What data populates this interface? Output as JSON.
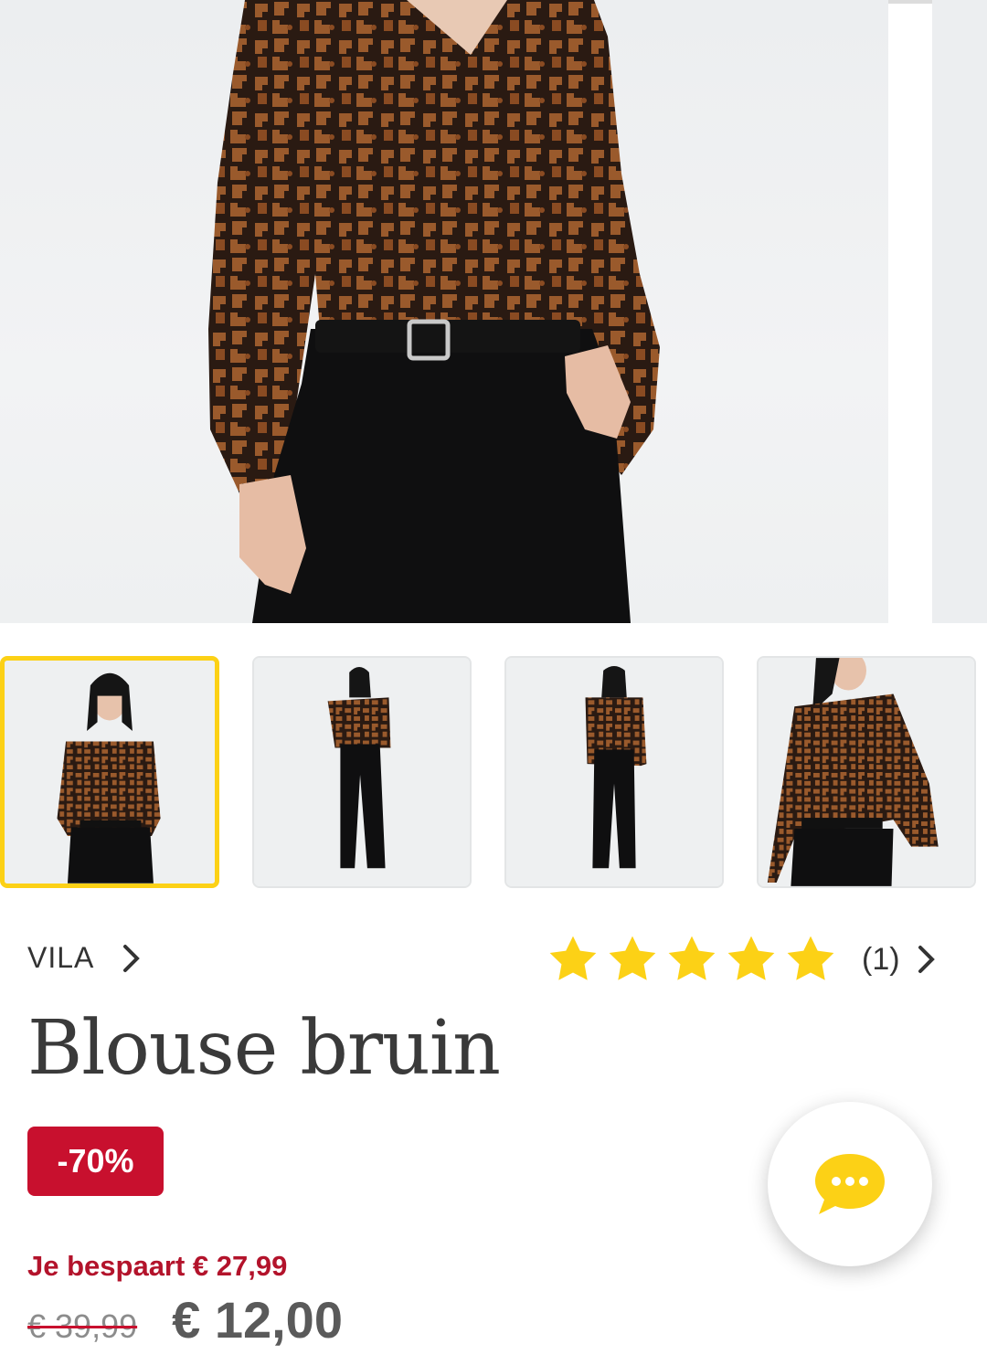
{
  "gallery": {
    "main_image_alt": "Model wearing brown leopard print blouse with black trousers and belt",
    "thumbnails": [
      {
        "id": "front",
        "active": true
      },
      {
        "id": "full-front",
        "active": false
      },
      {
        "id": "back",
        "active": false
      },
      {
        "id": "side",
        "active": false
      }
    ]
  },
  "product": {
    "brand": "VILA",
    "title": "Blouse bruin",
    "rating": 5,
    "review_count": "(1)",
    "discount_badge": "-70%",
    "saving_text": "Je bespaart € 27,99",
    "old_price": "€ 39,99",
    "new_price": "€ 12,00"
  },
  "colors": {
    "accent_yellow": "#fcd116",
    "sale_red": "#c8102e",
    "star": "#fcd116"
  },
  "icons": {
    "brand_chevron": "chevron-right-icon",
    "rating_chevron": "chevron-right-icon",
    "star": "star-icon",
    "chat": "chat-bubble-icon"
  }
}
